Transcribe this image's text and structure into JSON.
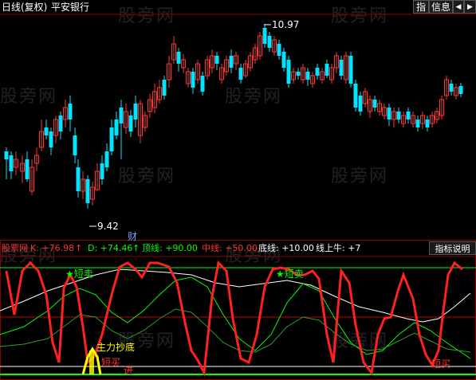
{
  "header": {
    "period_label": "日线(复权)",
    "stock_name": "平安银行",
    "btn_fuquan": "指",
    "btn_info": "信息",
    "btn_prev": "◀",
    "btn_next": "▶"
  },
  "price_panel": {
    "high_label": "10.97",
    "low_label": "9.42",
    "cai_marker": "财"
  },
  "indicator_panel": {
    "name": "股票网",
    "k_label": "K: +76.98",
    "d_label": "D: +74.46",
    "top_label": "顶线: +90.00",
    "mid_label": "中线: +50.00",
    "bottom_label": "底线: +10.00",
    "up_label": "线上牛: +7",
    "explain_button": "指标说明",
    "sell_signal_1": "★短卖",
    "sell_signal_2": "★短卖",
    "main_bottom": "主力抄底",
    "buy_short": "短买",
    "buy_enter": "进",
    "buy_short_2": "短买",
    "arrow_up": "↑",
    "arrow_up_2": "↑"
  },
  "watermark": "股 旁 网",
  "colors": {
    "up": "#ff3333",
    "down": "#00e5ff",
    "green_line": "#00ff00",
    "red_line": "#ff2020",
    "yellow": "#ffff00",
    "white": "#ffffff"
  }
}
